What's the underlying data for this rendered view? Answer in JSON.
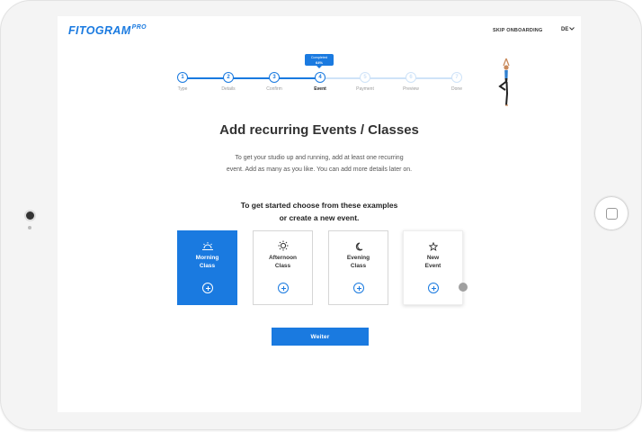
{
  "header": {
    "logo_main": "FITOGRAM",
    "logo_pro": "PRO",
    "skip_label": "SKIP ONBOARDING",
    "language": "DE"
  },
  "stepper": {
    "progress_tooltip_line1": "Completed",
    "progress_tooltip_line2": "64%",
    "progress_percent": 64,
    "steps": [
      {
        "number": "1",
        "label": "Type",
        "state": "done"
      },
      {
        "number": "2",
        "label": "Details",
        "state": "done"
      },
      {
        "number": "3",
        "label": "Confirm",
        "state": "done"
      },
      {
        "number": "4",
        "label": "Event",
        "state": "active"
      },
      {
        "number": "5",
        "label": "Payment",
        "state": "todo"
      },
      {
        "number": "6",
        "label": "Preview",
        "state": "todo"
      },
      {
        "number": "7",
        "label": "Done",
        "state": "todo"
      }
    ]
  },
  "main": {
    "title": "Add recurring Events / Classes",
    "subtitle_line1": "To get your studio up and running, add at least one recurring",
    "subtitle_line2": "event. Add as many as you like. You can add more details later on.",
    "choose_line1": "To get started choose from these examples",
    "choose_line2": "or create a new event."
  },
  "cards": [
    {
      "line1": "Morning",
      "line2": "Class",
      "icon": "sunrise-icon",
      "selected": true
    },
    {
      "line1": "Afternoon",
      "line2": "Class",
      "icon": "sun-icon",
      "selected": false
    },
    {
      "line1": "Evening",
      "line2": "Class",
      "icon": "moon-icon",
      "selected": false
    },
    {
      "line1": "New",
      "line2": "Event",
      "icon": "star-icon",
      "selected": false
    }
  ],
  "continue_label": "Weiter",
  "colors": {
    "accent": "#1a7ae0",
    "accent_light": "#cfe3f8",
    "text_dark": "#333333"
  }
}
